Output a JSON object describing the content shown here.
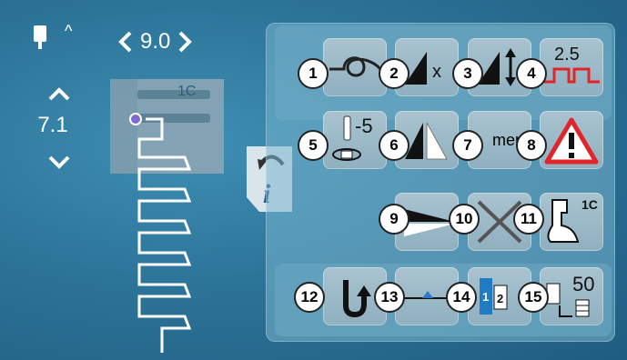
{
  "left_panel": {
    "stitch_width": "9.0",
    "stitch_length": "7.1",
    "presser_foot_label": "1C"
  },
  "buttons": [
    {
      "badge": "1",
      "icon": "securing-knot-icon"
    },
    {
      "badge": "2",
      "icon": "stitch-width-icon",
      "text": "x"
    },
    {
      "badge": "3",
      "icon": "stitch-length-icon"
    },
    {
      "badge": "4",
      "icon": "pattern-extend-icon",
      "text": "2.5"
    },
    {
      "badge": "5",
      "icon": "needle-position-icon",
      "text": "-5"
    },
    {
      "badge": "6",
      "icon": "mirror-image-icon"
    },
    {
      "badge": "7",
      "icon": "memory-icon",
      "text": "mem"
    },
    {
      "badge": "8",
      "icon": "warning-icon"
    },
    {
      "badge": "9",
      "icon": "balance-icon"
    },
    {
      "badge": "10",
      "icon": "cancel-icon"
    },
    {
      "badge": "11",
      "icon": "presser-foot-icon",
      "text": "1C"
    },
    {
      "badge": "12",
      "icon": "reverse-icon"
    },
    {
      "badge": "13",
      "icon": "stitch-counter-icon"
    },
    {
      "badge": "14",
      "icon": "pattern-repeat-icon",
      "text1": "1",
      "text2": "2"
    },
    {
      "badge": "15",
      "icon": "bobbin-icon",
      "text": "50"
    }
  ],
  "colors": {
    "accent_red": "#e0252a",
    "accent_blue": "#1e7bc4"
  }
}
